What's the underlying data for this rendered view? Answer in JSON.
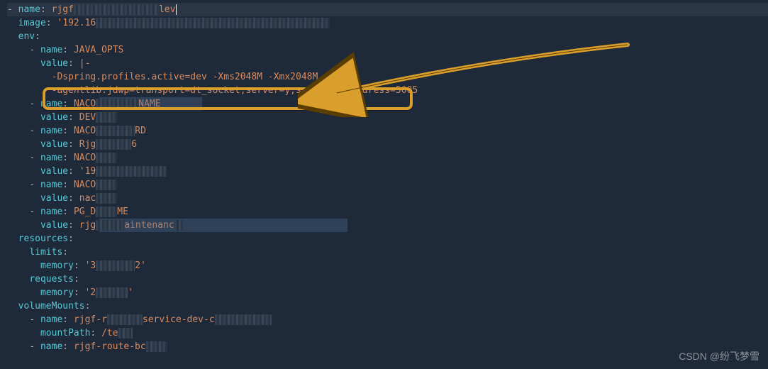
{
  "watermark": "CSDN @纷飞梦雪",
  "callout": {
    "highlighted_line": "-agentlib:jdwp=transport=dt_socket,server=y,suspend=n,address=5005",
    "color": "#d99e2b"
  },
  "yaml": {
    "top": {
      "name_key": "name",
      "name_prefix": "rjgf",
      "name_suffix": "lev"
    },
    "image": {
      "key": "image",
      "prefix": "'192.16"
    },
    "env_key": "env",
    "env": [
      {
        "name_key": "name",
        "name_val": "JAVA_OPTS",
        "value_key": "value",
        "value_pipe": "|-",
        "line1_prefix": "-Dspring.profiles.active=dev -Xms2048M -Xmx2048M",
        "line2": "-agentlib:jdwp=transport=dt_socket,server=y,suspend=n,address=5005"
      },
      {
        "name_key": "name",
        "name_prefix": "NACO",
        "name_suffix": "NAME",
        "value_key": "value",
        "value_prefix": "DEV"
      },
      {
        "name_key": "name",
        "name_prefix": "NACO",
        "name_suffix": "RD",
        "value_key": "value",
        "value_prefix": "Rjg",
        "value_suffix": "6"
      },
      {
        "name_key": "name",
        "name_prefix": "NACO",
        "value_key": "value",
        "value_prefix": "'19"
      },
      {
        "name_key": "name",
        "name_prefix": "NACO",
        "value_key": "value",
        "value_prefix": "nac"
      },
      {
        "name_key": "name",
        "name_prefix": "PG_D",
        "name_suffix": "ME",
        "value_key": "value",
        "value_prefix": "rjg",
        "value_suffix": "aintenanc"
      }
    ],
    "resources": {
      "key": "resources",
      "limits_key": "limits",
      "limits_memory_key": "memory",
      "limits_memory_prefix": "'3",
      "limits_memory_suffix": "2'",
      "requests_key": "requests",
      "requests_memory_key": "memory",
      "requests_memory_prefix": "'2",
      "requests_memory_suffix": "'"
    },
    "volumeMounts": {
      "key": "volumeMounts",
      "items": [
        {
          "name_key": "name",
          "name_prefix": "rjgf-r",
          "name_mid": "service-dev-c",
          "mountPath_key": "mountPath",
          "mountPath_prefix": "/te"
        },
        {
          "name_key": "name",
          "name_prefix": "rjgf-route-bc"
        }
      ]
    }
  }
}
